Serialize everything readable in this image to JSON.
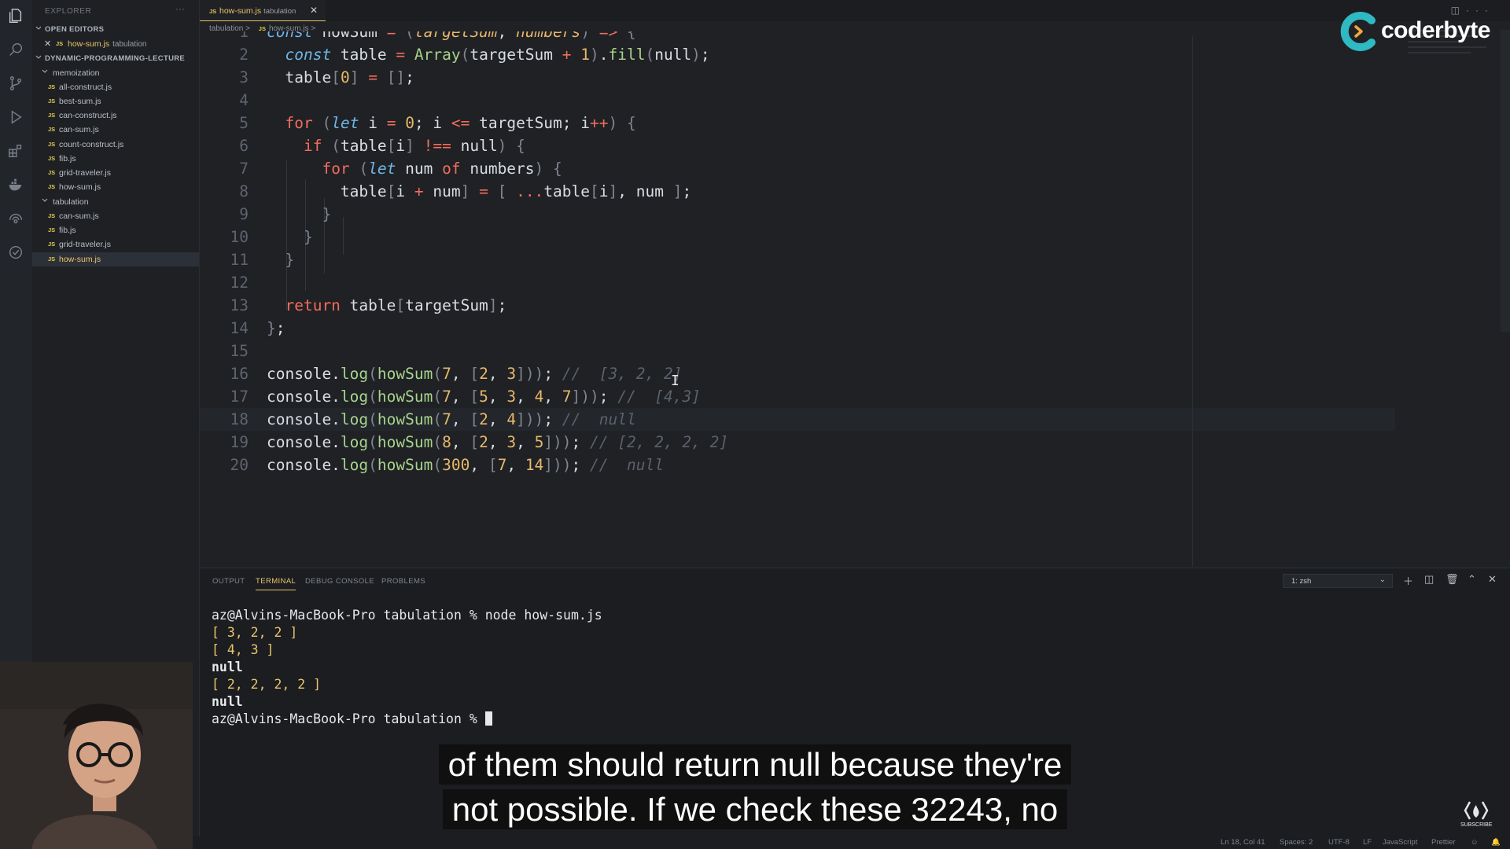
{
  "app": {
    "accent_color": "#e9c46a",
    "background_color": "#1f2125"
  },
  "sidebar": {
    "header": "EXPLORER",
    "open_editors_label": "OPEN EDITORS",
    "open_editor": {
      "name": "how-sum.js",
      "folder": "tabulation",
      "icon": "js-file-icon"
    },
    "project_label": "DYNAMIC-PROGRAMMING-LECTURE",
    "folders": [
      {
        "name": "memoization",
        "files": [
          "all-construct.js",
          "best-sum.js",
          "can-construct.js",
          "can-sum.js",
          "count-construct.js",
          "fib.js",
          "grid-traveler.js",
          "how-sum.js"
        ]
      },
      {
        "name": "tabulation",
        "files": [
          "can-sum.js",
          "fib.js",
          "grid-traveler.js",
          "how-sum.js"
        ]
      }
    ]
  },
  "editor": {
    "tab": {
      "name": "how-sum.js",
      "folder": "tabulation"
    },
    "breadcrumb": {
      "folder": "tabulation",
      "file": "how-sum.js",
      "separator": ">"
    },
    "active_line": 18,
    "line_numbers": [
      "1",
      "2",
      "3",
      "4",
      "5",
      "6",
      "7",
      "8",
      "9",
      "10",
      "11",
      "12",
      "13",
      "14",
      "15",
      "16",
      "17",
      "18",
      "19",
      "20"
    ]
  },
  "panel": {
    "tabs": [
      "OUTPUT",
      "TERMINAL",
      "DEBUG CONSOLE",
      "PROBLEMS"
    ],
    "active_tab": "TERMINAL",
    "terminal_select": "1: zsh",
    "terminal": {
      "prompt": "az@Alvins-MacBook-Pro tabulation % ",
      "command": "node how-sum.js",
      "output": [
        "[ 3, 2, 2 ]",
        "[ 4, 3 ]",
        "null",
        "[ 2, 2, 2, 2 ]",
        "null"
      ]
    }
  },
  "statusbar": {
    "position": "Ln 18, Col 41",
    "spaces": "Spaces: 2",
    "encoding": "UTF-8",
    "eol": "LF",
    "language": "JavaScript",
    "formatter": "Prettier"
  },
  "overlay": {
    "logo_text": "coderbyte",
    "subtitle_lines": [
      "of them should return null because they're",
      "not possible. If we check these 32243, no"
    ],
    "channel_badge": "SUBSCRIBE"
  }
}
